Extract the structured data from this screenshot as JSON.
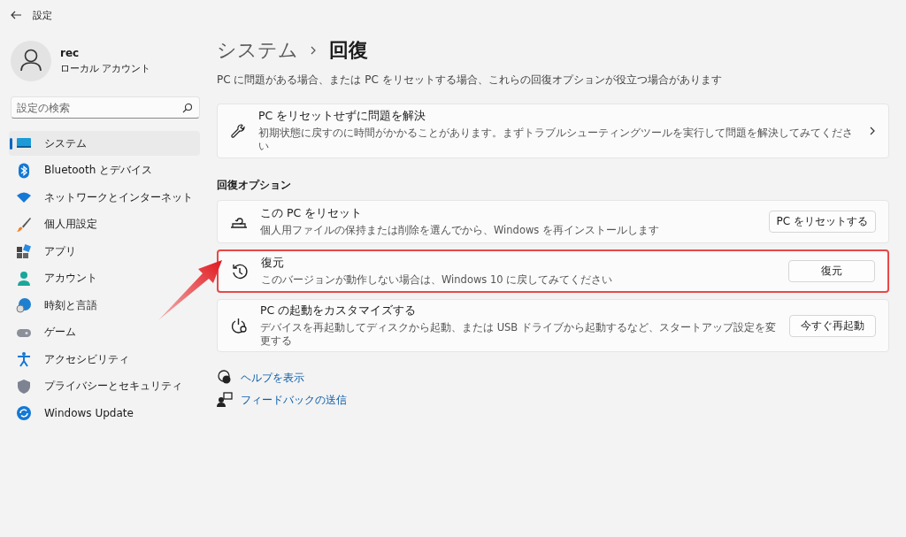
{
  "window": {
    "title": "設定"
  },
  "user": {
    "name": "rec",
    "account_type": "ローカル アカウント"
  },
  "search": {
    "placeholder": "設定の検索"
  },
  "sidebar": {
    "items": [
      {
        "kind": "system",
        "label": "システム",
        "selected": true
      },
      {
        "kind": "bluetooth",
        "label": "Bluetooth とデバイス",
        "selected": false
      },
      {
        "kind": "network",
        "label": "ネットワークとインターネット",
        "selected": false
      },
      {
        "kind": "personalize",
        "label": "個人用設定",
        "selected": false
      },
      {
        "kind": "apps",
        "label": "アプリ",
        "selected": false
      },
      {
        "kind": "account",
        "label": "アカウント",
        "selected": false
      },
      {
        "kind": "time",
        "label": "時刻と言語",
        "selected": false
      },
      {
        "kind": "game",
        "label": "ゲーム",
        "selected": false
      },
      {
        "kind": "accessibility",
        "label": "アクセシビリティ",
        "selected": false
      },
      {
        "kind": "privacy",
        "label": "プライバシーとセキュリティ",
        "selected": false
      },
      {
        "kind": "update",
        "label": "Windows Update",
        "selected": false
      }
    ]
  },
  "breadcrumb": [
    "システム",
    "回復"
  ],
  "description": "PC に問題がある場合、または PC をリセットする場合、これらの回復オプションが役立つ場合があります",
  "troubleshoot_card": {
    "title": "PC をリセットせずに問題を解決",
    "description": "初期状態に戻すのに時間がかかることがあります。まずトラブルシューティングツールを実行して問題を解決してみてください"
  },
  "section_heading": "回復オプション",
  "options": [
    {
      "kind": "reset",
      "title": "この PC をリセット",
      "description": "個人用ファイルの保持または削除を選んでから、Windows を再インストールします",
      "button": "PC をリセットする",
      "highlighted": false
    },
    {
      "kind": "restore",
      "title": "復元",
      "description": "このバージョンが動作しない場合は、Windows 10 に戻してみてください",
      "button": "復元",
      "highlighted": true
    },
    {
      "kind": "startup",
      "title": "PC の起動をカスタマイズする",
      "description": "デバイスを再起動してディスクから起動、または USB ドライブから起動するなど、スタートアップ設定を変更する",
      "button": "今すぐ再起動",
      "highlighted": false
    }
  ],
  "links": [
    {
      "kind": "help",
      "label": "ヘルプを表示"
    },
    {
      "kind": "feedback",
      "label": "フィードバックの送信"
    }
  ]
}
